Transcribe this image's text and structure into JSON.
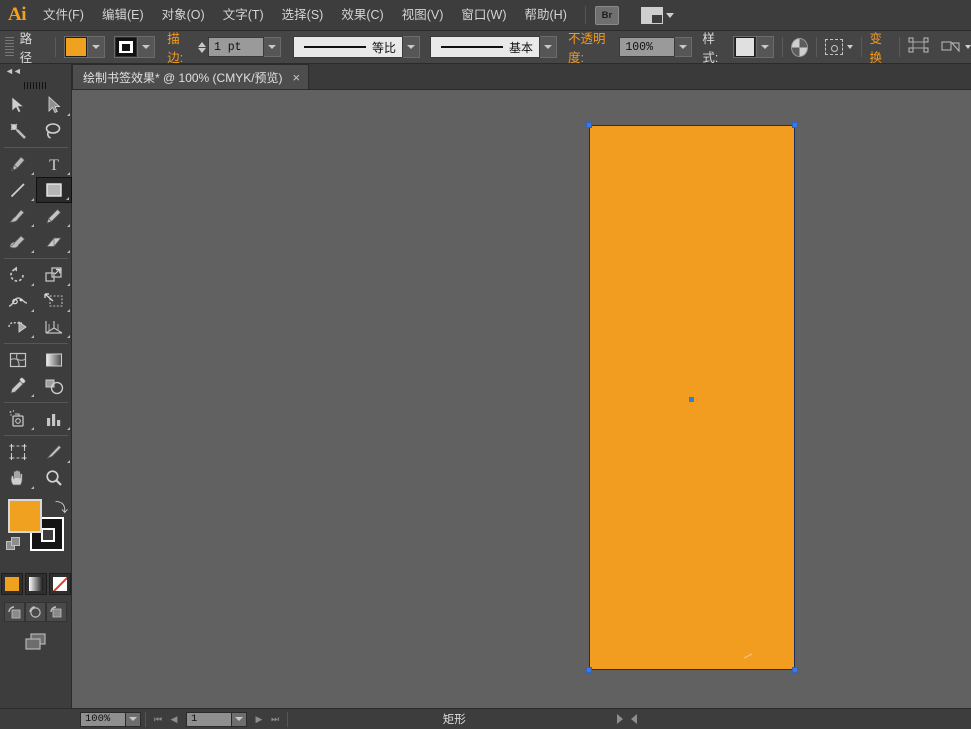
{
  "app": {
    "name": "Ai",
    "logo_color": "#f6a019"
  },
  "menubar": {
    "items": [
      {
        "label": "文件(F)",
        "name": "menu-file"
      },
      {
        "label": "编辑(E)",
        "name": "menu-edit"
      },
      {
        "label": "对象(O)",
        "name": "menu-object"
      },
      {
        "label": "文字(T)",
        "name": "menu-type"
      },
      {
        "label": "选择(S)",
        "name": "menu-select"
      },
      {
        "label": "效果(C)",
        "name": "menu-effect"
      },
      {
        "label": "视图(V)",
        "name": "menu-view"
      },
      {
        "label": "窗口(W)",
        "name": "menu-window"
      },
      {
        "label": "帮助(H)",
        "name": "menu-help"
      }
    ],
    "bridge_button": "Br",
    "workspace_switcher": "workspace-icon"
  },
  "controlbar": {
    "selection_label": "路径",
    "fill_color": "#f0a11f",
    "fill_swatch_name": "fill-swatch",
    "stroke_swatch_name": "stroke-swatch",
    "stroke_label": "描边:",
    "stroke_weight": "1 pt",
    "stroke_profile": "等比",
    "brush_definition": "基本",
    "opacity_label": "不透明度:",
    "opacity_value": "100%",
    "style_label": "样式:",
    "transparency_icon": "opacity-circle-icon",
    "select_similar_icon": "select-similar-icon",
    "transform_label": "变换",
    "align_icon": "align-icon",
    "distribute_icon": "distribute-icon"
  },
  "tabbar": {
    "document_title": "绘制书签效果* @ 100% (CMYK/预览)",
    "close_glyph": "×"
  },
  "toolbar": {
    "collapse_glyph": "◄◄",
    "tools": [
      {
        "name": "tool-selection",
        "label": "选择工具",
        "corner": false,
        "active": false
      },
      {
        "name": "tool-direct-selection",
        "label": "直接选择工具",
        "corner": true,
        "active": false
      },
      {
        "name": "tool-magic-wand",
        "label": "魔棒工具",
        "corner": false,
        "active": false
      },
      {
        "name": "tool-lasso",
        "label": "套索工具",
        "corner": false,
        "active": false
      },
      {
        "name": "tool-pen",
        "label": "钢笔工具",
        "corner": true,
        "active": false
      },
      {
        "name": "tool-type",
        "label": "文字工具",
        "corner": true,
        "active": false
      },
      {
        "name": "tool-line-segment",
        "label": "直线段工具",
        "corner": true,
        "active": false
      },
      {
        "name": "tool-rectangle",
        "label": "矩形工具",
        "corner": true,
        "active": true
      },
      {
        "name": "tool-paintbrush",
        "label": "画笔工具",
        "corner": true,
        "active": false
      },
      {
        "name": "tool-pencil",
        "label": "铅笔工具",
        "corner": true,
        "active": false
      },
      {
        "name": "tool-blob-brush",
        "label": "斑点画笔工具",
        "corner": true,
        "active": false
      },
      {
        "name": "tool-eraser",
        "label": "橡皮擦工具",
        "corner": true,
        "active": false
      },
      {
        "name": "tool-rotate",
        "label": "旋转工具",
        "corner": true,
        "active": false
      },
      {
        "name": "tool-scale",
        "label": "比例缩放工具",
        "corner": true,
        "active": false
      },
      {
        "name": "tool-width",
        "label": "宽度工具",
        "corner": true,
        "active": false
      },
      {
        "name": "tool-free-transform",
        "label": "自由变换工具",
        "corner": true,
        "active": false
      },
      {
        "name": "tool-shape-builder",
        "label": "形状生成器工具",
        "corner": true,
        "active": false
      },
      {
        "name": "tool-perspective-grid",
        "label": "透视网格工具",
        "corner": true,
        "active": false
      },
      {
        "name": "tool-mesh",
        "label": "网格工具",
        "corner": false,
        "active": false
      },
      {
        "name": "tool-gradient",
        "label": "渐变工具",
        "corner": false,
        "active": false
      },
      {
        "name": "tool-eyedropper",
        "label": "吸管工具",
        "corner": true,
        "active": false
      },
      {
        "name": "tool-blend",
        "label": "混合工具",
        "corner": false,
        "active": false
      },
      {
        "name": "tool-symbol-sprayer",
        "label": "符号喷枪工具",
        "corner": true,
        "active": false
      },
      {
        "name": "tool-column-graph",
        "label": "柱形图工具",
        "corner": true,
        "active": false
      },
      {
        "name": "tool-artboard",
        "label": "画板工具",
        "corner": false,
        "active": false
      },
      {
        "name": "tool-slice",
        "label": "切片工具",
        "corner": true,
        "active": false
      },
      {
        "name": "tool-hand",
        "label": "抓手工具",
        "corner": true,
        "active": false
      },
      {
        "name": "tool-zoom",
        "label": "缩放工具",
        "corner": false,
        "active": false
      }
    ],
    "fill_color": "#f0a11f",
    "stroke_color": "#141414",
    "swap_icon": "swap-fill-stroke-icon",
    "default_icon": "default-fill-stroke-icon",
    "paint_modes": [
      {
        "name": "paint-color-button",
        "label": "颜色"
      },
      {
        "name": "paint-gradient-button",
        "label": "渐变"
      },
      {
        "name": "paint-none-button",
        "label": "无"
      }
    ],
    "draw_modes": [
      {
        "name": "draw-normal-button",
        "label": "正常绘图"
      },
      {
        "name": "draw-behind-button",
        "label": "背面绘图"
      },
      {
        "name": "draw-inside-button",
        "label": "内部绘图"
      }
    ],
    "screen_mode": {
      "name": "screen-mode-button",
      "label": "更改屏幕模式"
    }
  },
  "canvas": {
    "background_color": "#616161",
    "shape": {
      "name": "rectangle-shape",
      "fill": "#f29d1f",
      "stroke": "#1b2f5e",
      "selected": true,
      "handles": [
        "top-left",
        "top-right",
        "bottom-left",
        "bottom-right"
      ],
      "center_point_color": "#3b78e7"
    }
  },
  "statusbar": {
    "zoom_value": "100%",
    "page_value": "1",
    "status_text": "矩形",
    "first_page_icon": "first-page-icon",
    "prev_page_icon": "prev-page-icon",
    "next_page_icon": "next-page-icon",
    "last_page_icon": "last-page-icon",
    "expand_icon": "expand-status-icon",
    "collapse_icon": "collapse-status-icon"
  }
}
